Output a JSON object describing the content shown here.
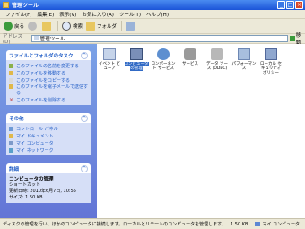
{
  "window": {
    "title": "管理ツール"
  },
  "menu": [
    "ファイル(F)",
    "編集(E)",
    "表示(V)",
    "お気に入り(A)",
    "ツール(T)",
    "ヘルプ(H)"
  ],
  "toolbar": {
    "back": "戻る",
    "search": "検索",
    "folders": "フォルダ"
  },
  "address": {
    "label": "アドレス(D)",
    "value": "管理ツール",
    "go": "移動"
  },
  "tasks_panel": {
    "title": "ファイルとフォルダのタスク",
    "items": [
      "このファイルの名前を変更する",
      "このファイルを移動する",
      "このファイルをコピーする",
      "このファイルを電子メールで送信する",
      "このファイルを削除する"
    ]
  },
  "places_panel": {
    "title": "その他",
    "items": [
      "コントロール パネル",
      "マイ ドキュメント",
      "マイ コンピュータ",
      "マイ ネットワーク"
    ]
  },
  "details_panel": {
    "title": "詳細",
    "name": "コンピュータの管理",
    "type": "ショートカット",
    "modified": "更新日時: 2010年6月7日, 10:55",
    "size": "サイズ: 1.50 KB"
  },
  "icons": [
    {
      "label": "イベント ビューア",
      "selected": false
    },
    {
      "label": "コンピュータの管理",
      "selected": true
    },
    {
      "label": "コンポーネント サービス",
      "selected": false
    },
    {
      "label": "サービス",
      "selected": false
    },
    {
      "label": "データ ソース (ODBC)",
      "selected": false
    },
    {
      "label": "パフォーマンス",
      "selected": false
    },
    {
      "label": "ローカル セキュリティ ポリシー",
      "selected": false
    }
  ],
  "status": {
    "text": "ディスクの管理を行い、ほかのコンピュータに接続します。ローカルとリモートのコンピュータを管理します。",
    "size": "1.50 KB",
    "location": "マイ コンピュータ"
  }
}
